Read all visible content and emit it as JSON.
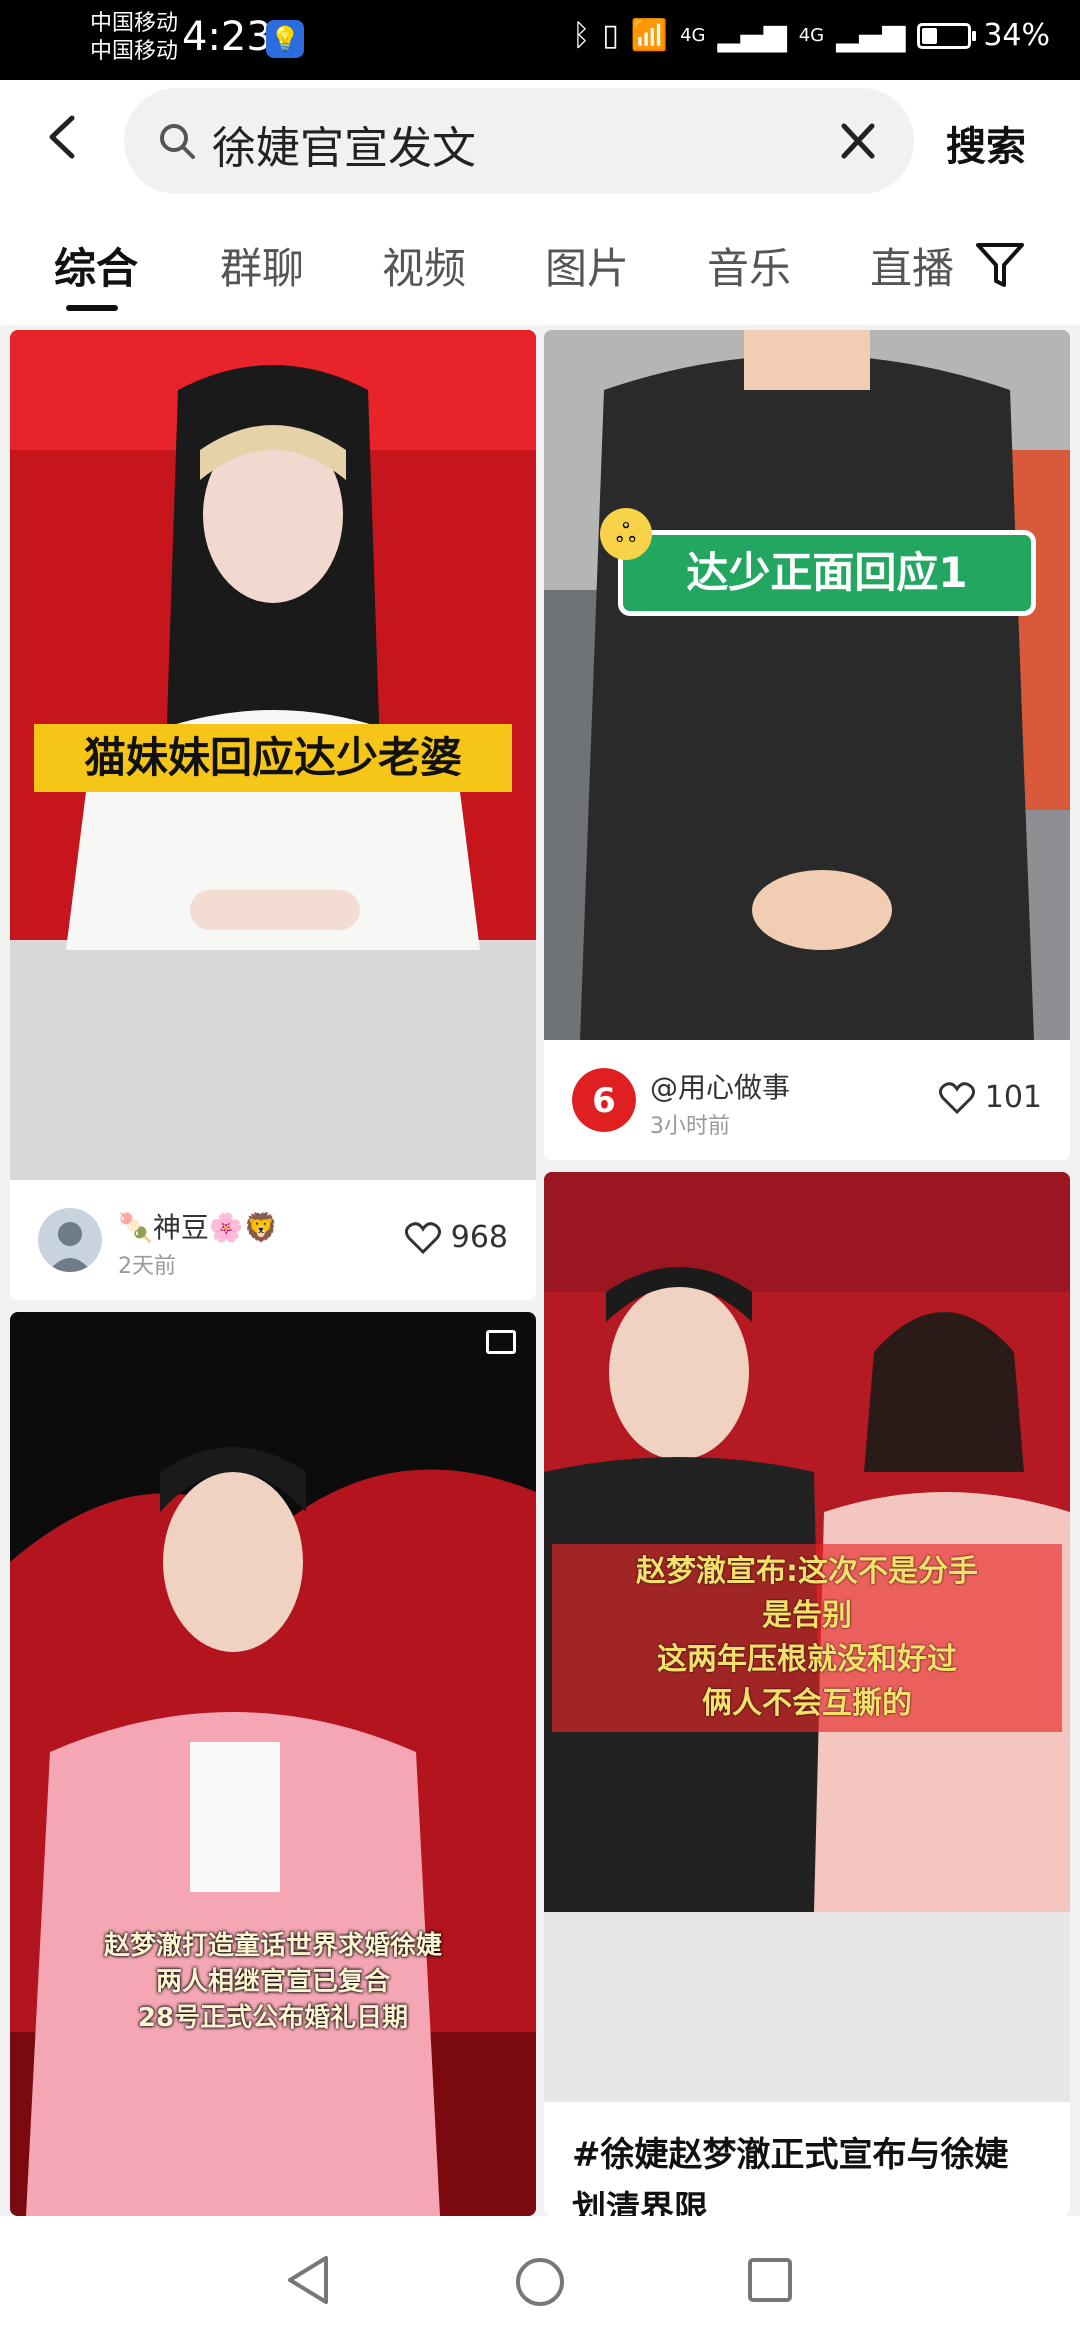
{
  "status": {
    "carrier1": "中国移动",
    "carrier2": "中国移动",
    "time": "4:23",
    "net1": "4G",
    "net2": "4G",
    "battery": "34%",
    "battery_level": 0.34
  },
  "search": {
    "query": "徐婕官宣发文",
    "button": "搜索"
  },
  "tabs": [
    "综合",
    "群聊",
    "视频",
    "图片",
    "音乐",
    "直播"
  ],
  "active_tab": "综合",
  "feed": [
    {
      "overlay": "猫妹妹回应达少老婆",
      "author": "🍡神豆🌸🦁",
      "time": "2天前",
      "likes": "968"
    },
    {
      "overlay": "达少正面回应1",
      "author": "@用心做事",
      "time": "3小时前",
      "likes": "101"
    },
    {
      "overlay": [
        "赵梦澈打造童话世界求婚徐婕",
        "两人相继官宣已复合",
        "28号正式公布婚礼日期"
      ]
    },
    {
      "overlay": [
        "赵梦澈宣布:这次不是分手",
        "是告别",
        "这两年压根就没和好过",
        "俩人不会互撕的"
      ],
      "title": "#徐婕赵梦澈正式宣布与徐婕划清界限"
    }
  ],
  "colors": {
    "overlay_yellow": "#f5c517",
    "overlay_green": "#23a760",
    "like_icon": "#333333",
    "brand_red": "#e02020"
  }
}
